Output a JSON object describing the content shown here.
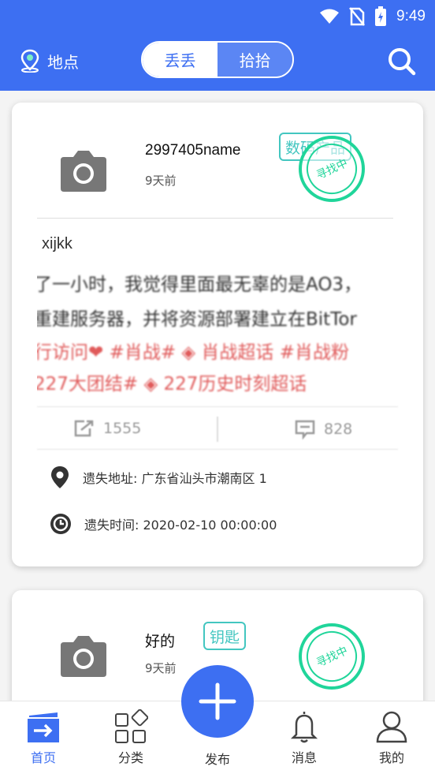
{
  "status_bar": {
    "time": "9:49"
  },
  "header": {
    "location_label": "地点",
    "segment": [
      "丢丢",
      "拾拾"
    ]
  },
  "posts": [
    {
      "username": "2997405name",
      "time_ago": "9天前",
      "category": "数码产品",
      "stamp": "寻找中",
      "title": "xijkk",
      "image_lines": [
        "了一小时，我觉得里面最无辜的是AO3，",
        "重建服务器，并将资源部署建立在BitTor",
        "行访问❤ #肖战#  ◈ 肖战超话 #肖战粉",
        "227大团结#  ◈ 227历史时刻超话"
      ],
      "shares": "1555",
      "comments": "828",
      "address_label": "遗失地址: 广东省汕头市潮南区 1",
      "time_label": "遗失时间: 2020-02-10 00:00:00"
    },
    {
      "username": "好的",
      "time_ago": "9天前",
      "category": "钥匙",
      "stamp": "寻找中"
    }
  ],
  "nav": {
    "home": "首页",
    "category": "分类",
    "publish": "发布",
    "messages": "消息",
    "mine": "我的"
  },
  "colors": {
    "primary": "#3d6ff2",
    "tag": "#43c6c0",
    "stamp": "#20d59a"
  }
}
